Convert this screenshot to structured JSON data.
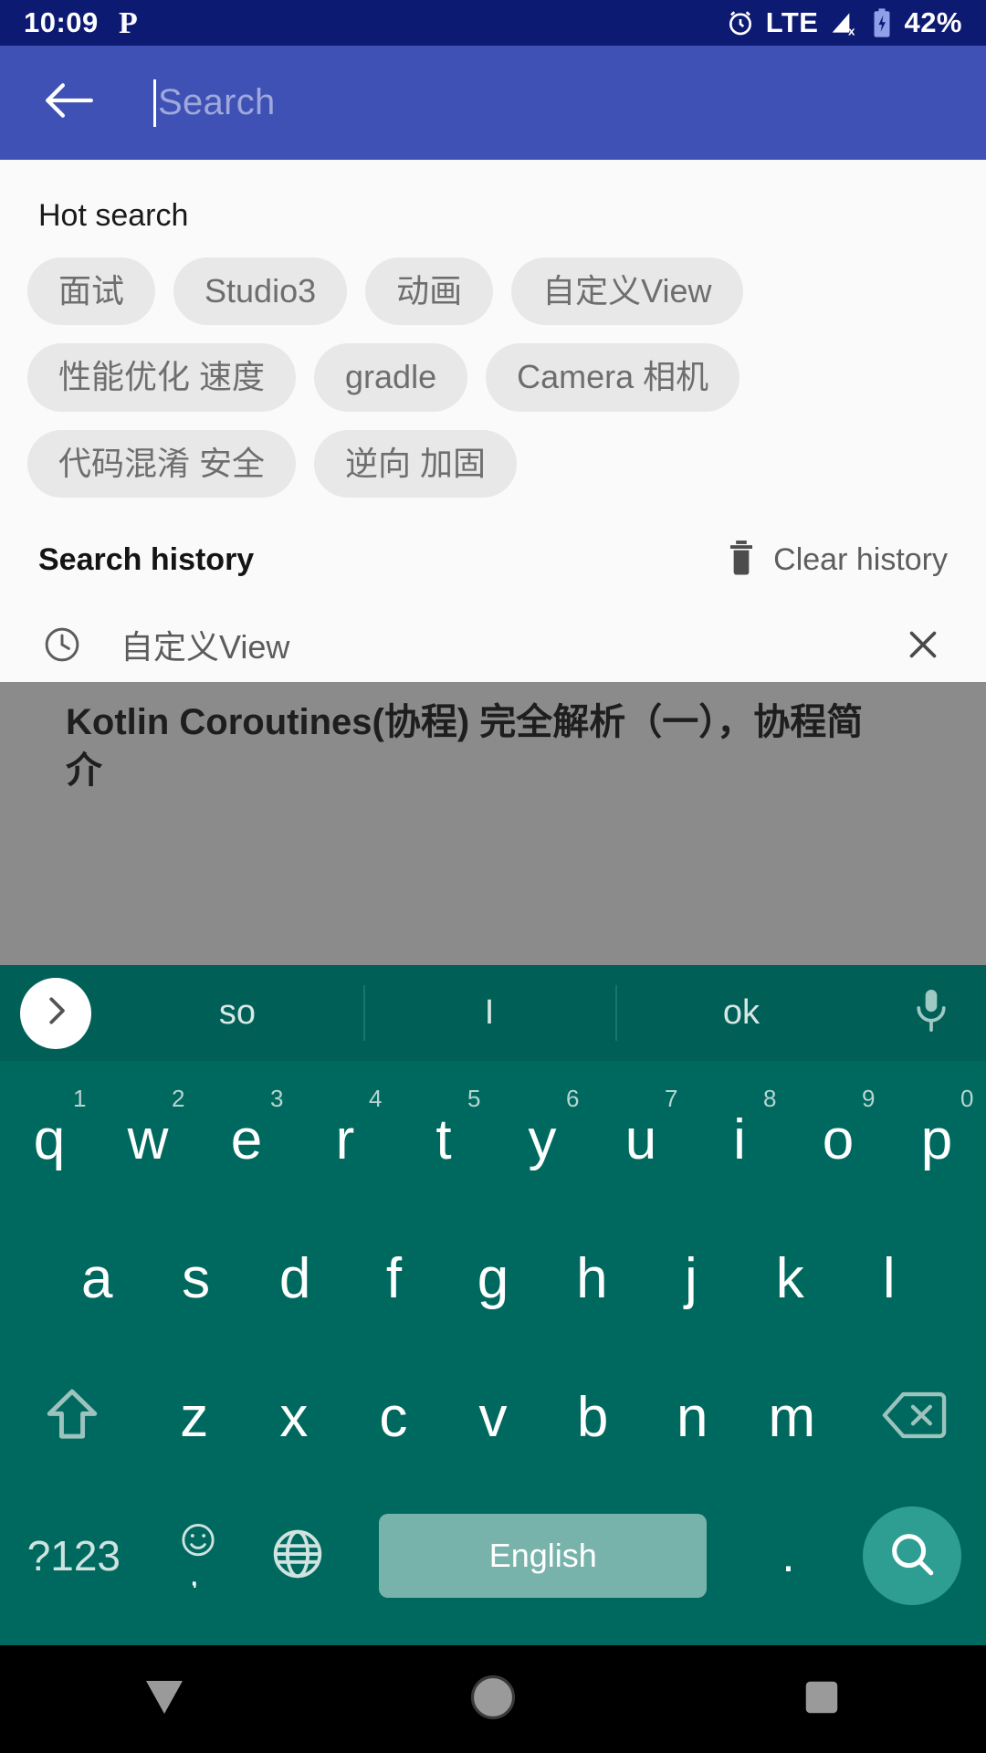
{
  "status_bar": {
    "time": "10:09",
    "app_icon": "paypal-icon",
    "alarm_icon": "alarm-icon",
    "network": "LTE",
    "signal_icon": "signal-no-service-icon",
    "battery_icon": "battery-charging-icon",
    "battery": "42%",
    "background": "#0d1a72"
  },
  "app_bar": {
    "back_icon": "back-arrow-icon",
    "search_placeholder": "Search",
    "search_value": "",
    "background": "#3f51b5"
  },
  "hot_search": {
    "title": "Hot search",
    "chips": [
      "面试",
      "Studio3",
      "动画",
      "自定义View",
      "性能优化 速度",
      "gradle",
      "Camera 相机",
      "代码混淆 安全",
      "逆向 加固"
    ]
  },
  "search_history": {
    "title": "Search history",
    "clear_label": "Clear history",
    "clear_icon": "trash-icon",
    "items": [
      {
        "icon": "clock-icon",
        "text": "自定义View",
        "remove_icon": "close-icon"
      }
    ]
  },
  "background_page": {
    "article_title": "Kotlin Coroutines(协程) 完全解析（一），协程简介"
  },
  "keyboard": {
    "background": "#00695f",
    "suggestion_bar": {
      "expand_icon": "chevron-right-icon",
      "suggestions": [
        "so",
        "I",
        "ok"
      ],
      "mic_icon": "microphone-icon"
    },
    "row1": [
      {
        "key": "q",
        "num": "1"
      },
      {
        "key": "w",
        "num": "2"
      },
      {
        "key": "e",
        "num": "3"
      },
      {
        "key": "r",
        "num": "4"
      },
      {
        "key": "t",
        "num": "5"
      },
      {
        "key": "y",
        "num": "6"
      },
      {
        "key": "u",
        "num": "7"
      },
      {
        "key": "i",
        "num": "8"
      },
      {
        "key": "o",
        "num": "9"
      },
      {
        "key": "p",
        "num": "0"
      }
    ],
    "row2": [
      "a",
      "s",
      "d",
      "f",
      "g",
      "h",
      "j",
      "k",
      "l"
    ],
    "row3": {
      "shift_icon": "shift-icon",
      "keys": [
        "z",
        "x",
        "c",
        "v",
        "b",
        "n",
        "m"
      ],
      "backspace_icon": "backspace-icon"
    },
    "row4": {
      "symbols_label": "?123",
      "emoji_icon": "emoji-comma-icon",
      "globe_icon": "globe-icon",
      "space_label": "English",
      "period_label": ".",
      "search_icon": "search-icon"
    }
  },
  "nav_bar": {
    "back_icon": "down-triangle-icon",
    "home_icon": "home-circle-icon",
    "recents_icon": "recents-square-icon"
  }
}
